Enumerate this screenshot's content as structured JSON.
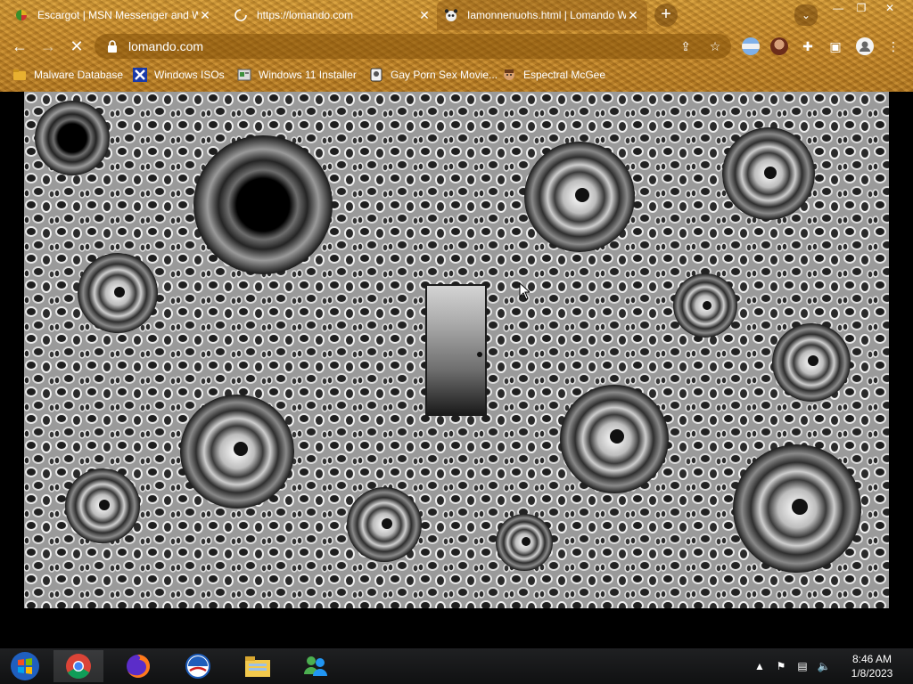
{
  "browser": {
    "tabs": [
      {
        "title": "Escargot | MSN Messenger and W",
        "icon": "escargot-icon"
      },
      {
        "title": "https://lomando.com",
        "icon": "loading-spinner-icon"
      },
      {
        "title": "Iamonnenuohs.html | Lomando Wi",
        "icon": "panda-icon"
      }
    ],
    "new_tab_label": "+",
    "address": "lomando.com",
    "bookmarks": [
      {
        "label": "Malware Database",
        "icon": "malware-folder-icon"
      },
      {
        "label": "Windows ISOs",
        "icon": "x-icon"
      },
      {
        "label": "Windows 11 Installer",
        "icon": "installer-icon"
      },
      {
        "label": "Gay Porn Sex Movie...",
        "icon": "bookmark-site-icon"
      },
      {
        "label": "Espectral McGee",
        "icon": "character-icon"
      }
    ]
  },
  "page": {
    "description_accent": "#8e8e8e"
  },
  "taskbar": {
    "time": "8:46 AM",
    "date": "1/8/2023"
  }
}
